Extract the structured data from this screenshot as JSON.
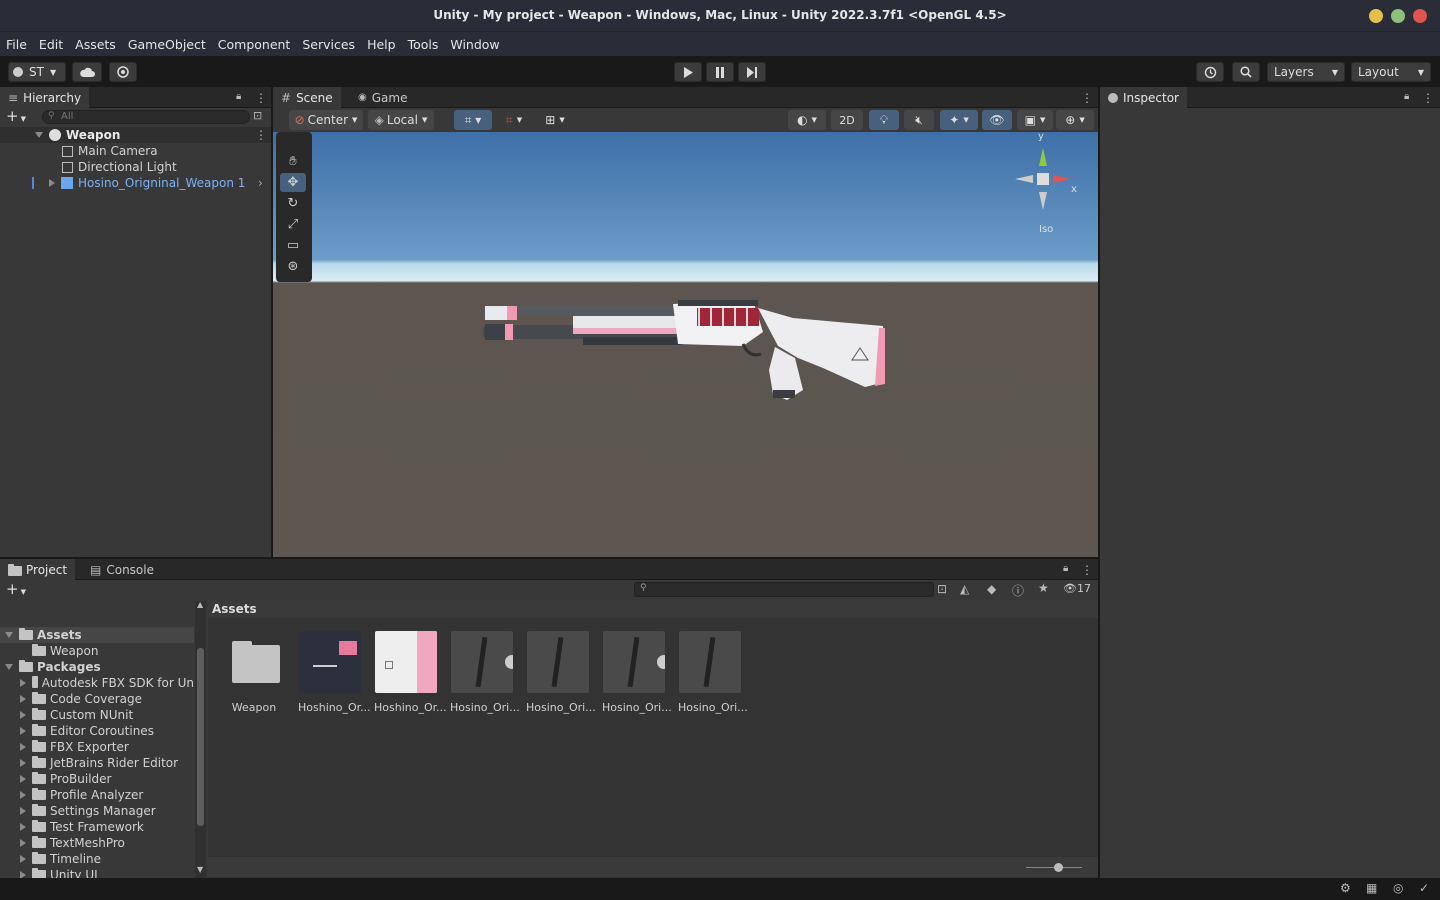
{
  "window": {
    "title": "Unity - My project - Weapon - Windows, Mac, Linux - Unity 2022.3.7f1 <OpenGL 4.5>"
  },
  "menu": [
    "File",
    "Edit",
    "Assets",
    "GameObject",
    "Component",
    "Services",
    "Help",
    "Tools",
    "Window"
  ],
  "toolbar": {
    "account": "ST",
    "layers": "Layers",
    "layout": "Layout"
  },
  "hierarchy": {
    "tab": "Hierarchy",
    "search_placeholder": "All",
    "scene": "Weapon",
    "items": [
      "Main Camera",
      "Directional Light",
      "Hosino_Origninal_Weapon 1"
    ]
  },
  "scene_view": {
    "tabs": [
      "Scene",
      "Game"
    ],
    "pivot": "Center",
    "space": "Local",
    "mode_2d": "2D",
    "gizmo": {
      "y": "y",
      "x": "x",
      "projection": "Iso"
    }
  },
  "inspector": {
    "tab": "Inspector"
  },
  "project": {
    "tabs": [
      "Project",
      "Console"
    ],
    "hidden_count": "17",
    "breadcrumb": "Assets",
    "tree": {
      "assets_label": "Assets",
      "assets_children": [
        "Weapon"
      ],
      "packages_label": "Packages",
      "packages": [
        "Autodesk FBX SDK for Un",
        "Code Coverage",
        "Custom NUnit",
        "Editor Coroutines",
        "FBX Exporter",
        "JetBrains Rider Editor",
        "ProBuilder",
        "Profile Analyzer",
        "Settings Manager",
        "Test Framework",
        "TextMeshPro",
        "Timeline",
        "Unity UI"
      ]
    },
    "assets": [
      "Weapon",
      "Hoshino_Or...",
      "Hoshino_Or...",
      "Hosino_Ori...",
      "Hosino_Ori...",
      "Hosino_Ori...",
      "Hosino_Ori..."
    ]
  },
  "colors": {
    "accent": "#4d8ad9",
    "selection_text": "#7fb0f5",
    "panel": "#383838",
    "scene_ground": "#5c5550",
    "window_close": "#e0534e",
    "window_min": "#e6c14a",
    "window_max": "#8ec07c"
  }
}
